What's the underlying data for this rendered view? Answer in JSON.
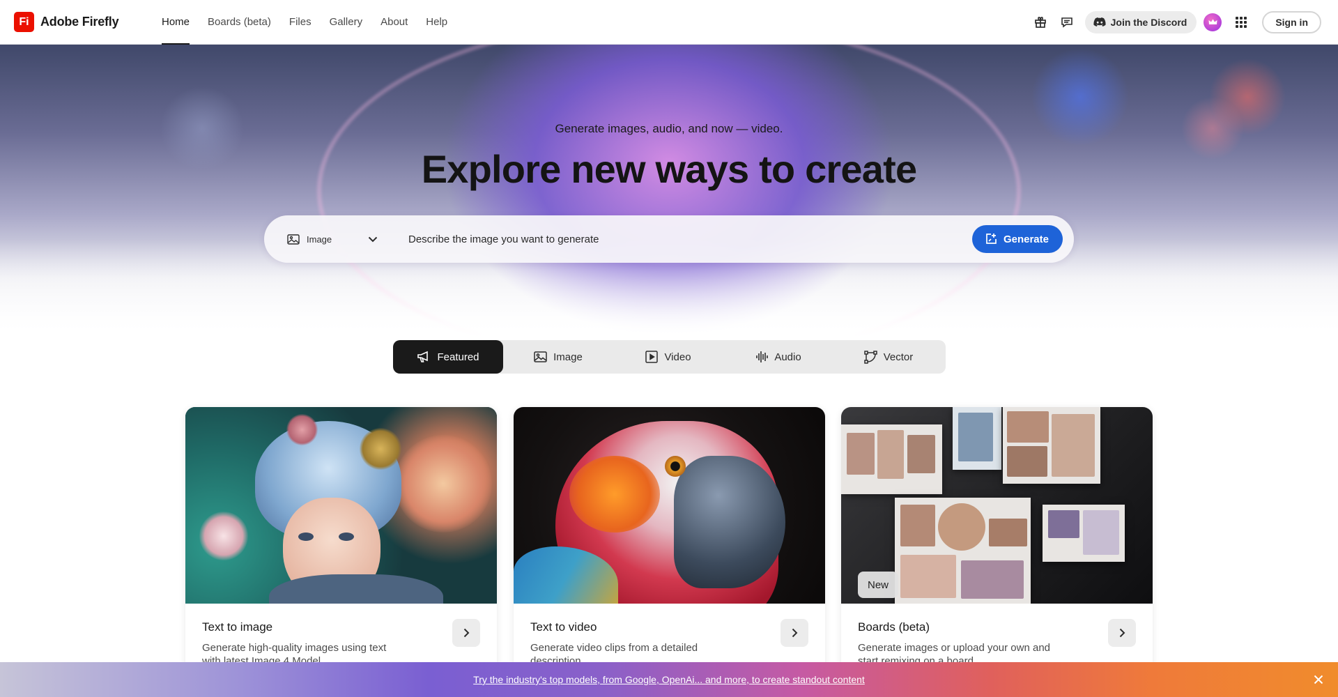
{
  "nav": {
    "brand_logo": "Fi",
    "brand_name": "Adobe Firefly",
    "links": [
      {
        "label": "Home",
        "active": true
      },
      {
        "label": "Boards (beta)",
        "active": false
      },
      {
        "label": "Files",
        "active": false
      },
      {
        "label": "Gallery",
        "active": false
      },
      {
        "label": "About",
        "active": false
      },
      {
        "label": "Help",
        "active": false
      }
    ],
    "icons": [
      "gift-icon",
      "feedback-icon",
      "discord-icon",
      "apps-grid-icon"
    ],
    "discord_label": "Join the Discord",
    "signin_label": "Sign in"
  },
  "hero": {
    "subtitle": "Generate images, audio, and now — video.",
    "title": "Explore new ways to create",
    "media_type": "Image",
    "prompt_placeholder": "Describe the image you want to generate",
    "generate_label": "Generate",
    "accent_color": "#1e63d8"
  },
  "tabs": [
    {
      "label": "Featured",
      "icon": "megaphone-icon",
      "active": true
    },
    {
      "label": "Image",
      "icon": "image-icon",
      "active": false
    },
    {
      "label": "Video",
      "icon": "video-icon",
      "active": false
    },
    {
      "label": "Audio",
      "icon": "audio-wave-icon",
      "active": false
    },
    {
      "label": "Vector",
      "icon": "vector-icon",
      "active": false
    }
  ],
  "cards": [
    {
      "title": "Text to image",
      "description": "Generate high-quality images using text with latest Image 4 Model",
      "badge": ""
    },
    {
      "title": "Text to video",
      "description": "Generate video clips from a detailed description",
      "badge": ""
    },
    {
      "title": "Boards (beta)",
      "description": "Generate images or upload your own and start remixing on a board",
      "badge": "New"
    }
  ],
  "promo": {
    "text": "Try the industry's top models, from Google, OpenAi... and more, to create standout content"
  }
}
